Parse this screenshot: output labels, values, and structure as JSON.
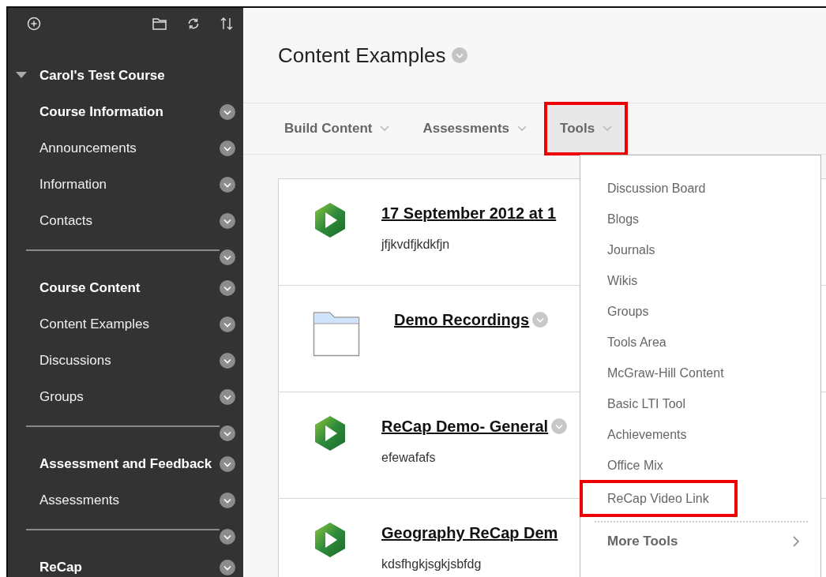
{
  "sidebar": {
    "course": {
      "title": "Carol's Test Course",
      "expanded": true
    },
    "items": [
      {
        "kind": "header",
        "label": "Course Information"
      },
      {
        "kind": "link",
        "label": "Announcements"
      },
      {
        "kind": "link",
        "label": "Information"
      },
      {
        "kind": "link",
        "label": "Contacts"
      },
      {
        "kind": "divider"
      },
      {
        "kind": "header",
        "label": "Course Content"
      },
      {
        "kind": "link",
        "label": "Content Examples"
      },
      {
        "kind": "link",
        "label": "Discussions"
      },
      {
        "kind": "link",
        "label": "Groups"
      },
      {
        "kind": "divider"
      },
      {
        "kind": "header",
        "label": "Assessment and Feedback"
      },
      {
        "kind": "link",
        "label": "Assessments"
      },
      {
        "kind": "divider"
      },
      {
        "kind": "header",
        "label": "ReCap"
      }
    ]
  },
  "page": {
    "title": "Content Examples"
  },
  "action_bar": [
    {
      "label": "Build Content",
      "selected": false,
      "highlighted": false
    },
    {
      "label": "Assessments",
      "selected": false,
      "highlighted": false
    },
    {
      "label": "Tools",
      "selected": true,
      "highlighted": true
    }
  ],
  "content_items": [
    {
      "kind": "video",
      "title": "17 September 2012 at 1",
      "description": "jfjkvdfjkdkfjn",
      "menu": false
    },
    {
      "kind": "folder",
      "title": "Demo Recordings",
      "menu": true
    },
    {
      "kind": "video",
      "title": "ReCap Demo- General",
      "description": "efewafafs",
      "menu": true
    },
    {
      "kind": "video",
      "title": "Geography ReCap Dem",
      "description": "kdsfhgkjsgkjsbfdg",
      "menu": false
    }
  ],
  "tools_menu": {
    "items": [
      {
        "label": "Discussion Board",
        "highlighted": false
      },
      {
        "label": "Blogs",
        "highlighted": false
      },
      {
        "label": "Journals",
        "highlighted": false
      },
      {
        "label": "Wikis",
        "highlighted": false
      },
      {
        "label": "Groups",
        "highlighted": false
      },
      {
        "label": "Tools Area",
        "highlighted": false
      },
      {
        "label": "McGraw-Hill Content",
        "highlighted": false
      },
      {
        "label": "Basic LTI Tool",
        "highlighted": false
      },
      {
        "label": "Achievements",
        "highlighted": false
      },
      {
        "label": "Office Mix",
        "highlighted": false
      },
      {
        "label": "ReCap Video Link",
        "highlighted": true
      }
    ],
    "more": {
      "label": "More Tools"
    }
  }
}
